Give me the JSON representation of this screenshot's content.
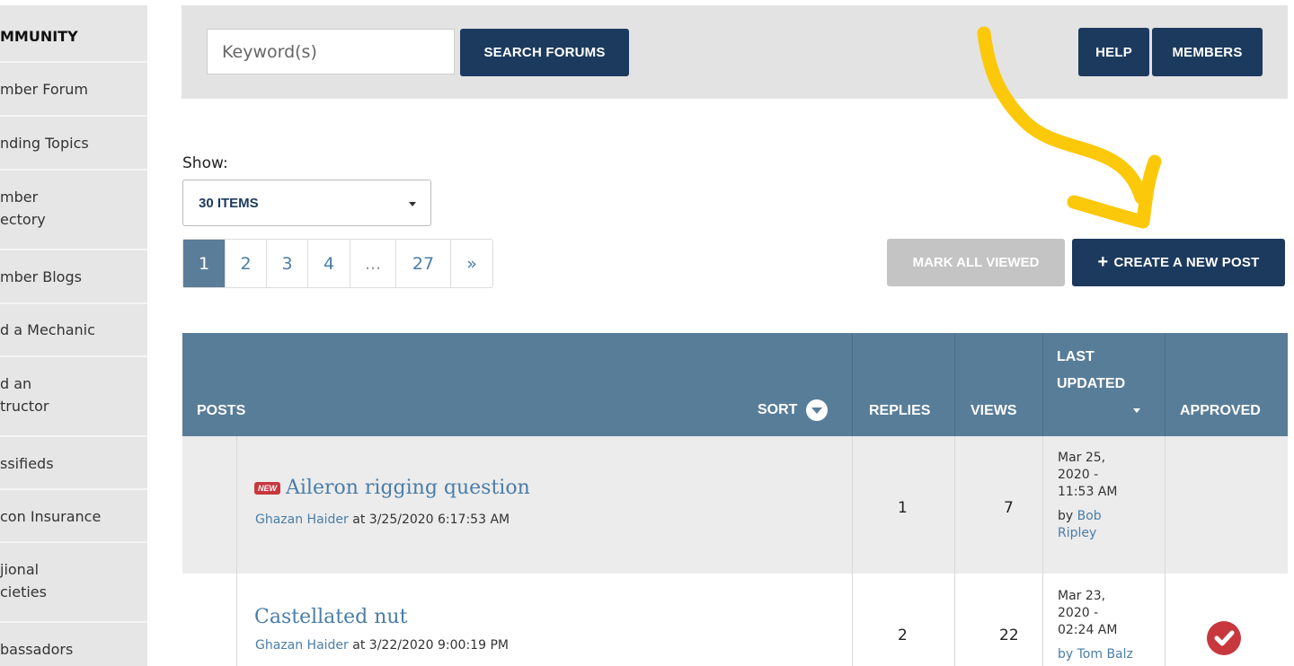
{
  "sidebar": {
    "items": [
      {
        "label": "MMUNITY"
      },
      {
        "label": "mber Forum"
      },
      {
        "label": "nding Topics"
      },
      {
        "label": "mber",
        "label2": "ectory"
      },
      {
        "label": "mber Blogs"
      },
      {
        "label": "d a Mechanic"
      },
      {
        "label": "d an",
        "label2": "tructor"
      },
      {
        "label": "ssifieds"
      },
      {
        "label": "con Insurance"
      },
      {
        "label": "jional",
        "label2": "cieties"
      },
      {
        "label": "bassadors"
      }
    ]
  },
  "search": {
    "placeholder": "Keyword(s)",
    "button": "SEARCH FORUMS",
    "help": "HELP",
    "members": "MEMBERS"
  },
  "show": {
    "label": "Show:",
    "selected": "30 ITEMS"
  },
  "pagination": {
    "pages": [
      "1",
      "2",
      "3",
      "4",
      "...",
      "27",
      "»"
    ]
  },
  "actions": {
    "mark_all": "MARK ALL VIEWED",
    "create": "CREATE A NEW POST",
    "create_icon": "+"
  },
  "table": {
    "headers": {
      "posts": "POSTS",
      "sort": "SORT",
      "replies": "REPLIES",
      "views": "VIEWS",
      "last_updated_1": "LAST",
      "last_updated_2": "UPDATED",
      "approved": "APPROVED"
    },
    "rows": [
      {
        "badge": "NEW",
        "title": "Aileron rigging question",
        "author": "Ghazan Haider",
        "at": "at 3/25/2020 6:17:53 AM",
        "replies": "1",
        "views": "7",
        "lu1": "Mar 25,",
        "lu2": "2020 -",
        "lu3": "11:53 AM",
        "by": "by",
        "by_name1": "Bob",
        "by_name2": "Ripley"
      },
      {
        "title": "Castellated nut",
        "author": "Ghazan Haider",
        "at": "at 3/22/2020 9:00:19 PM",
        "replies": "2",
        "views": "22",
        "lu1": "Mar 23,",
        "lu2": "2020 -",
        "lu3": "02:24 AM",
        "by_partial": "by Tom Balz"
      }
    ]
  },
  "colors": {
    "navy": "#1c3a5e",
    "table_header": "#587d98",
    "link": "#4a7da8",
    "badge_red": "#c8373e",
    "annotation_yellow": "#fcc80a"
  }
}
